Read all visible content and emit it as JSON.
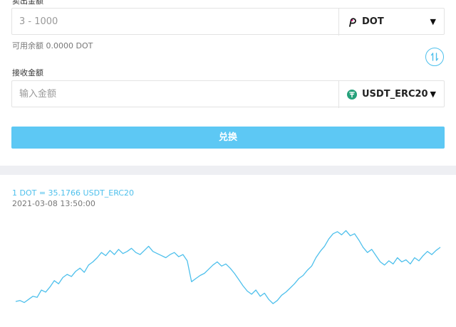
{
  "send": {
    "label": "卖出金额",
    "placeholder": "3 - 1000",
    "coin": "DOT",
    "coin_icon": "polkadot-icon",
    "available": "可用余额 0.0000 DOT"
  },
  "receive": {
    "label": "接收金额",
    "placeholder": "输入金额",
    "coin": "USDT_ERC20",
    "coin_icon": "tether-icon"
  },
  "swap_icon": "swap-vertical-icon",
  "submit_label": "兑换",
  "rate": {
    "text": "1 DOT = 35.1766 USDT_ERC20",
    "timestamp": "2021-03-08 13:50:00"
  },
  "colors": {
    "accent": "#5dc8f4",
    "line": "#4ec0ec",
    "polkadot": "#e6007a",
    "tether": "#26a17b"
  },
  "chart_data": {
    "type": "line",
    "series": [
      {
        "values": [
          30.4,
          30.5,
          30.3,
          30.6,
          30.9,
          30.8,
          31.5,
          31.3,
          31.8,
          32.4,
          32.1,
          32.7,
          33.0,
          32.8,
          33.3,
          33.6,
          33.2,
          33.9,
          34.2,
          34.6,
          35.1,
          34.8,
          35.3,
          34.9,
          35.4,
          35.0,
          35.2,
          35.5,
          35.1,
          34.9,
          35.3,
          35.7,
          35.2,
          35.0,
          34.8,
          34.6,
          34.9,
          35.1,
          34.7,
          34.9,
          34.3,
          32.3,
          32.6,
          32.9,
          33.1,
          33.5,
          33.9,
          34.2,
          33.8,
          34.0,
          33.6,
          33.1,
          32.5,
          31.9,
          31.4,
          31.1,
          31.5,
          30.9,
          31.2,
          30.6,
          30.2,
          30.5,
          31.0,
          31.3,
          31.7,
          32.1,
          32.6,
          32.9,
          33.4,
          33.8,
          34.6,
          35.2,
          35.7,
          36.4,
          36.9,
          37.1,
          36.8,
          37.2,
          36.7,
          36.9,
          36.3,
          35.6,
          35.1,
          35.4,
          34.8,
          34.2,
          33.9,
          34.3,
          34.0,
          34.6,
          34.2,
          34.4,
          34.0,
          34.6,
          34.3,
          34.8,
          35.2,
          34.9,
          35.3,
          35.6
        ]
      }
    ]
  }
}
